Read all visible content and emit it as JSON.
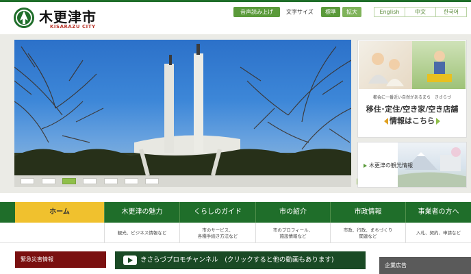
{
  "header": {
    "site_name": "木更津市",
    "site_sub": "KISARAZU CITY",
    "tts_button": "音声読み上げ",
    "font_size_label": "文字サイズ",
    "font_standard": "標準",
    "font_large": "拡大",
    "languages": [
      "English",
      "中文",
      "한국어"
    ]
  },
  "hero": {
    "slide_count": 7,
    "active_slide": 3
  },
  "side": {
    "card1_caption": "都会に一番近い自然があるまち　きさらづ",
    "card1_line1": "移住･定住/空き家/空き店舗",
    "card1_line2": "情報はこちら",
    "card2_label": "木更津の観光情報"
  },
  "nav": {
    "items": [
      {
        "label": "ホーム",
        "sub": ""
      },
      {
        "label": "木更津の魅力",
        "sub": "観光、ビジネス情報など"
      },
      {
        "label": "くらしのガイド",
        "sub": "市のサービス、\n各種手続き方法など"
      },
      {
        "label": "市の紹介",
        "sub": "市のプロフィール、\n施設情報など"
      },
      {
        "label": "市政情報",
        "sub": "市政、行政、まちづくり\n関連など"
      },
      {
        "label": "事業者の方へ",
        "sub": "入札、契約、申請など"
      }
    ]
  },
  "bottom": {
    "emergency": "緊急災害情報",
    "promo": "きさらづプロモチャンネル　(クリックすると他の動画もあります)",
    "ads": "企業広告"
  },
  "colors": {
    "brand_green": "#1f6e2a",
    "accent_yellow": "#f0c12e",
    "emergency_red": "#7a1010"
  }
}
